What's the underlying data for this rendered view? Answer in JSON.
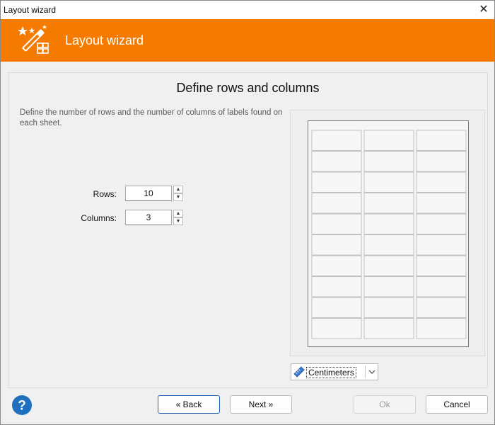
{
  "window": {
    "title": "Layout wizard",
    "close_glyph": "✕"
  },
  "header": {
    "title": "Layout wizard",
    "icon": "magic-wand-icon",
    "color": "#f47b00"
  },
  "main": {
    "heading": "Define rows and columns",
    "description": "Define the number of rows and the number of columns of labels found on each sheet.",
    "rows": {
      "label": "Rows:",
      "value": "10"
    },
    "columns": {
      "label": "Columns:",
      "value": "3"
    }
  },
  "preview": {
    "rows": 10,
    "columns": 3
  },
  "unit_select": {
    "value": "Centimeters",
    "icon": "ruler-pencil-icon"
  },
  "footer": {
    "back_label": "« Back",
    "next_label": "Next »",
    "ok_label": "Ok",
    "cancel_label": "Cancel",
    "help_icon": "help-icon"
  },
  "colors": {
    "accent": "#f47b00",
    "help_blue": "#1f6fbf",
    "primary_border": "#1e5fb5"
  }
}
